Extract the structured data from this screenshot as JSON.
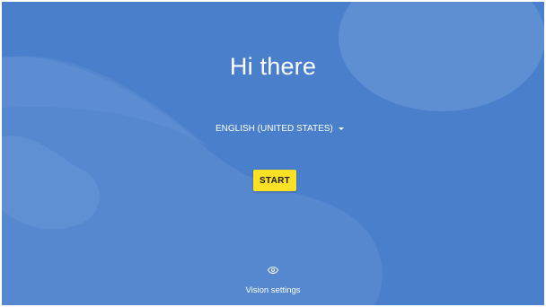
{
  "welcome": {
    "title": "Hi there",
    "language_selected": "ENGLISH (UNITED STATES)",
    "start_label": "START",
    "vision_settings_label": "Vision settings"
  },
  "icons": {
    "language_dropdown": "caret-down-icon",
    "vision": "eye-icon"
  },
  "colors": {
    "background": "#4a7fcb",
    "accent_button": "#fbe126",
    "text": "#ffffff"
  }
}
